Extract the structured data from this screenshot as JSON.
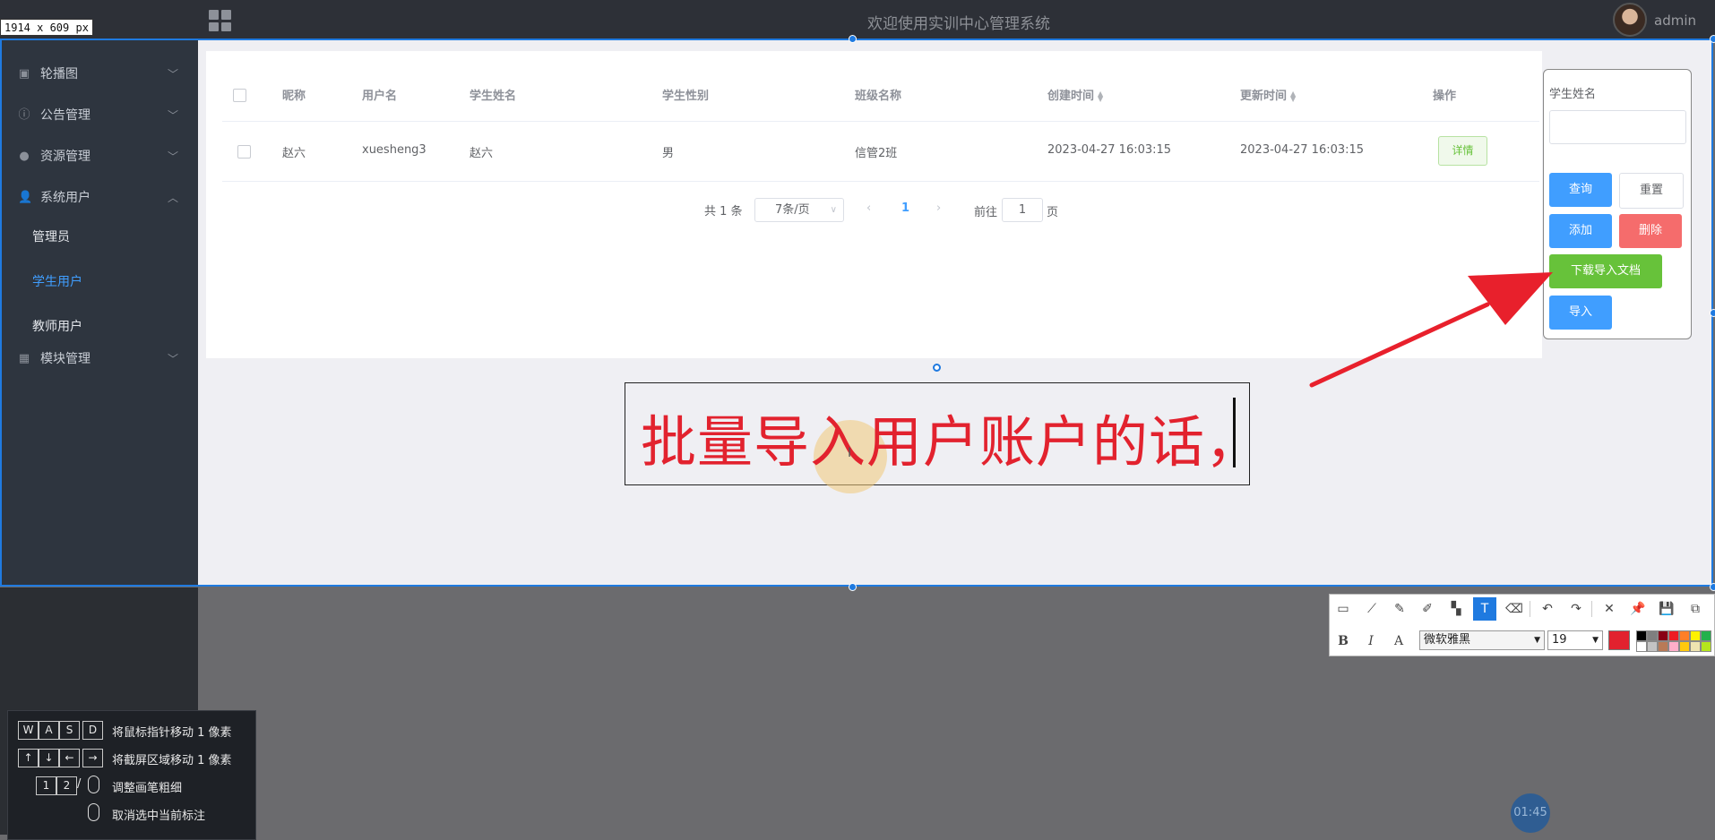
{
  "overlay": {
    "size_label": "1914 x 609  px"
  },
  "header": {
    "title": "欢迎使用实训中心管理系统",
    "user": "admin"
  },
  "sidebar": {
    "items": [
      {
        "label": "轮播图",
        "icon": "image-icon",
        "expanded": false
      },
      {
        "label": "公告管理",
        "icon": "info-icon",
        "expanded": false
      },
      {
        "label": "资源管理",
        "icon": "location-icon",
        "expanded": false
      },
      {
        "label": "系统用户",
        "icon": "user-icon",
        "expanded": true
      },
      {
        "label": "模块管理",
        "icon": "grid-icon",
        "expanded": false
      }
    ],
    "sub_items": [
      {
        "label": "管理员",
        "active": false
      },
      {
        "label": "学生用户",
        "active": true
      },
      {
        "label": "教师用户",
        "active": false
      }
    ]
  },
  "table": {
    "headers": [
      "昵称",
      "用户名",
      "学生姓名",
      "学生性别",
      "班级名称",
      "创建时间",
      "更新时间",
      "操作"
    ],
    "rows": [
      {
        "nickname": "赵六",
        "username": "xuesheng3",
        "name": "赵六",
        "gender": "男",
        "class": "信管2班",
        "created": "2023-04-27 16:03:15",
        "updated": "2023-04-27 16:03:15",
        "action": "详情"
      }
    ]
  },
  "pagination": {
    "total": "共 1 条",
    "page_size": "7条/页",
    "current": "1",
    "goto_label": "前往",
    "goto_value": "1",
    "page_label": "页",
    "prev": "‹",
    "next": "›"
  },
  "search_panel": {
    "label": "学生姓名",
    "buttons": {
      "query": "查询",
      "reset": "重置",
      "add": "添加",
      "delete": "删除",
      "download": "下载导入文档",
      "import": "导入"
    }
  },
  "annotation": {
    "text": "批量导入用户账户的话，",
    "color": "#e2222e"
  },
  "toolbar": {
    "font": "微软雅黑",
    "font_size": "19",
    "bold": "B",
    "italic": "I",
    "outline": "A",
    "current_color": "#e2222e",
    "swatches_top": [
      "#000000",
      "#7f7f7f",
      "#880015",
      "#ed1c24",
      "#ff7f27",
      "#fff200",
      "#22b14c"
    ],
    "swatches_bottom": [
      "#ffffff",
      "#c3c3c3",
      "#b97a57",
      "#ffaec9",
      "#ffc90e",
      "#efe4b0",
      "#b5e61d"
    ]
  },
  "shortcuts": [
    {
      "keys": [
        "W",
        "A",
        "S",
        "D"
      ],
      "text": "将鼠标指针移动 1 像素"
    },
    {
      "keys": [
        "↑",
        "↓",
        "←",
        "→"
      ],
      "text": "将截屏区域移动 1 像素"
    },
    {
      "keys": [
        "1",
        "2"
      ],
      "text": "调整画笔粗细"
    },
    {
      "keys": [],
      "text": "取消选中当前标注"
    }
  ],
  "timer": "01:45",
  "colors": {
    "accent": "#409eff",
    "success": "#67c23a",
    "danger": "#f56c6c",
    "selection": "#1f7ae0"
  }
}
